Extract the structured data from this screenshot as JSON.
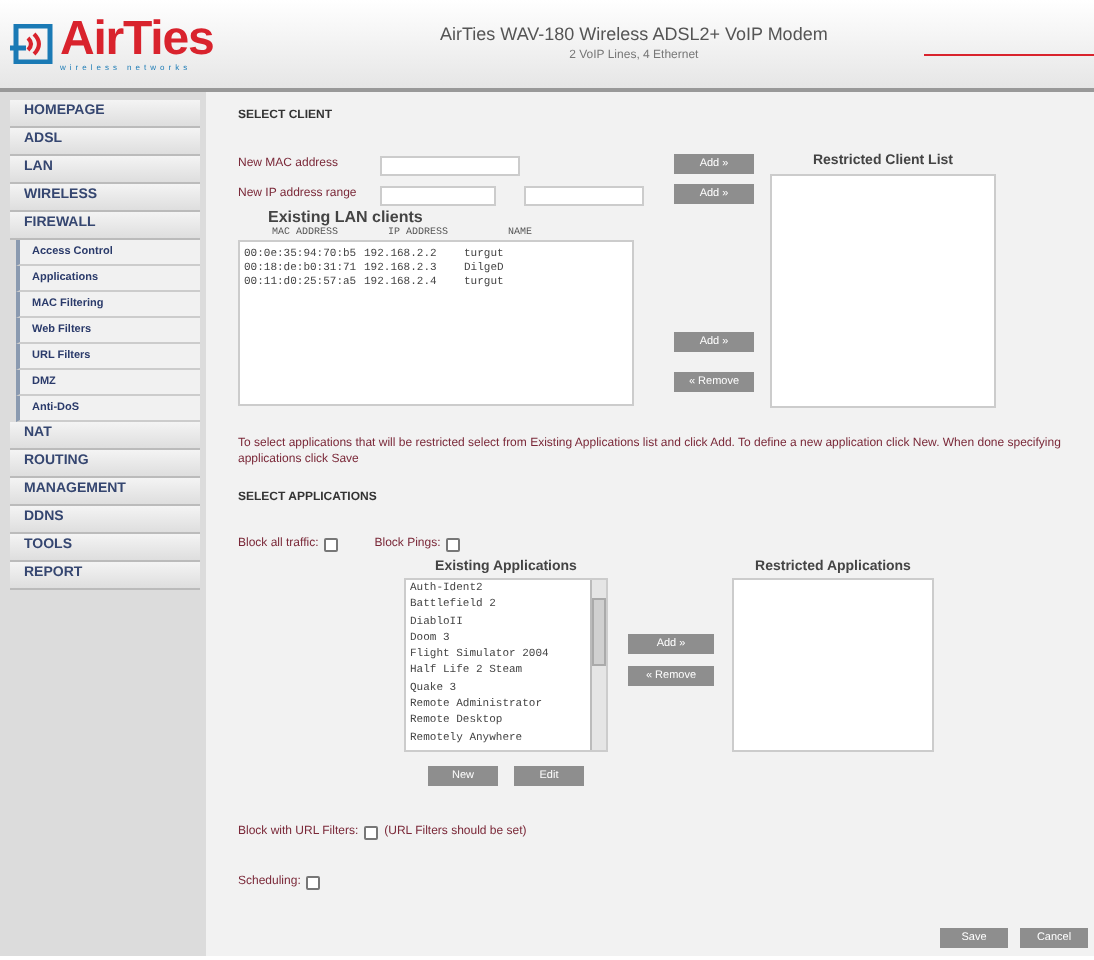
{
  "header": {
    "logo": "AirTies",
    "tagline": "wireless networks",
    "title": "AirTies WAV-180 Wireless ADSL2+ VoIP Modem",
    "subtitle": "2 VoIP Lines, 4 Ethernet"
  },
  "sidebar": {
    "items": [
      {
        "label": "HOMEPAGE",
        "kind": "section"
      },
      {
        "label": "ADSL",
        "kind": "section"
      },
      {
        "label": "LAN",
        "kind": "section"
      },
      {
        "label": "WIRELESS",
        "kind": "section"
      },
      {
        "label": "FIREWALL",
        "kind": "section"
      },
      {
        "label": "Access Control",
        "kind": "sub"
      },
      {
        "label": "Applications",
        "kind": "sub"
      },
      {
        "label": "MAC Filtering",
        "kind": "sub"
      },
      {
        "label": "Web Filters",
        "kind": "sub"
      },
      {
        "label": "URL Filters",
        "kind": "sub"
      },
      {
        "label": "DMZ",
        "kind": "sub"
      },
      {
        "label": "Anti-DoS",
        "kind": "sub"
      },
      {
        "label": "NAT",
        "kind": "section"
      },
      {
        "label": "ROUTING",
        "kind": "section"
      },
      {
        "label": "MANAGEMENT",
        "kind": "section"
      },
      {
        "label": "DDNS",
        "kind": "section"
      },
      {
        "label": "TOOLS",
        "kind": "section"
      },
      {
        "label": "REPORT",
        "kind": "section"
      }
    ]
  },
  "select_client": {
    "heading": "SELECT CLIENT",
    "mac_label": "New MAC address",
    "ip_label": "New IP address range",
    "add_buttons": [
      "Add »",
      "Add »"
    ],
    "existing_title": "Existing LAN clients",
    "columns": [
      "MAC ADDRESS",
      "IP ADDRESS",
      "NAME"
    ],
    "clients": [
      {
        "mac": "00:0e:35:94:70:b5",
        "ip": "192.168.2.2",
        "name": "turgut"
      },
      {
        "mac": "00:18:de:b0:31:71",
        "ip": "192.168.2.3",
        "name": "DilgeD"
      },
      {
        "mac": "00:11:d0:25:57:a5",
        "ip": "192.168.2.4",
        "name": "turgut"
      }
    ],
    "list_add": "Add »",
    "list_remove": "« Remove",
    "restricted_title": "Restricted Client List"
  },
  "instructions": "To select applications that will be restricted select from Existing Applications list and click Add. To define a new application click New. When done specifying applications click Save",
  "select_applications": {
    "heading": "SELECT APPLICATIONS",
    "options": [
      {
        "label": "Block all traffic:",
        "checked": false
      },
      {
        "label": "Block Pings:",
        "checked": false
      }
    ],
    "existing_title": "Existing Applications",
    "applications": [
      "Auth-Ident2",
      "Battlefield 2",
      "DiabloII",
      "Doom 3",
      "Flight Simulator 2004",
      "Half Life 2 Steam",
      "Quake 3",
      "Remote Administrator",
      "Remote Desktop",
      "Remotely Anywhere"
    ],
    "add": "Add »",
    "remove": "« Remove",
    "new": "New",
    "edit": "Edit",
    "restricted_title": "Restricted Applications"
  },
  "url_filter": {
    "label": "Block with URL Filters:",
    "checked": false,
    "note": "(URL Filters should be set)"
  },
  "scheduling": {
    "label": "Scheduling:",
    "checked": false
  },
  "buttons": [
    "Save",
    "Cancel"
  ]
}
